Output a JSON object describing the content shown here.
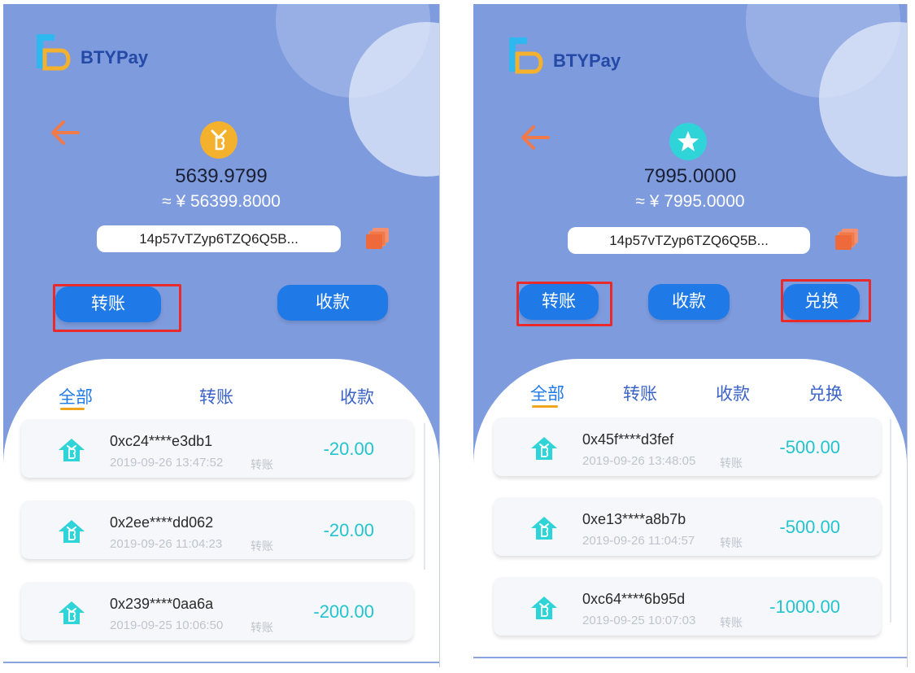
{
  "app": {
    "name": "BTYPay"
  },
  "left": {
    "balance": "5639.9799",
    "fiat": "≈ ¥ 56399.8000",
    "address": "14p57vTZyp6TZQ6Q5B...",
    "buttons": {
      "transfer": "转账",
      "receive": "收款"
    },
    "tabs": [
      "全部",
      "转账",
      "收款"
    ],
    "transactions": [
      {
        "address": "0xc24****e3db1",
        "time": "2019-09-26 13:47:52",
        "type": "转账",
        "amount": "-20.00"
      },
      {
        "address": "0x2ee****dd062",
        "time": "2019-09-26 11:04:23",
        "type": "转账",
        "amount": "-20.00"
      },
      {
        "address": "0x239****0aa6a",
        "time": "2019-09-25 10:06:50",
        "type": "转账",
        "amount": "-200.00"
      }
    ]
  },
  "right": {
    "balance": "7995.0000",
    "fiat": "≈ ¥ 7995.0000",
    "address": "14p57vTZyp6TZQ6Q5B...",
    "buttons": {
      "transfer": "转账",
      "receive": "收款",
      "exchange": "兑换"
    },
    "tabs": [
      "全部",
      "转账",
      "收款",
      "兑换"
    ],
    "transactions": [
      {
        "address": "0x45f****d3fef",
        "time": "2019-09-26 13:48:05",
        "type": "转账",
        "amount": "-500.00"
      },
      {
        "address": "0xe13****a8b7b",
        "time": "2019-09-26 11:04:57",
        "type": "转账",
        "amount": "-500.00"
      },
      {
        "address": "0xc64****6b95d",
        "time": "2019-09-25 10:07:03",
        "type": "转账",
        "amount": "-1000.00"
      }
    ]
  },
  "colors": {
    "header_bg": "#7e9bdd",
    "button": "#1f7ae8",
    "amount": "#22c4cf",
    "highlight": "#e82a2a",
    "coin_gold": "#f4b12e",
    "coin_teal": "#2fd4d9",
    "back_arrow": "#f07a4a",
    "copy_icon": "#f07a4a"
  },
  "icons": {
    "coin_left": "bitcoin-coin-icon",
    "coin_right": "star-coin-icon",
    "tx": "house-coin-icon",
    "copy": "copy-icon",
    "back": "back-arrow-icon"
  }
}
